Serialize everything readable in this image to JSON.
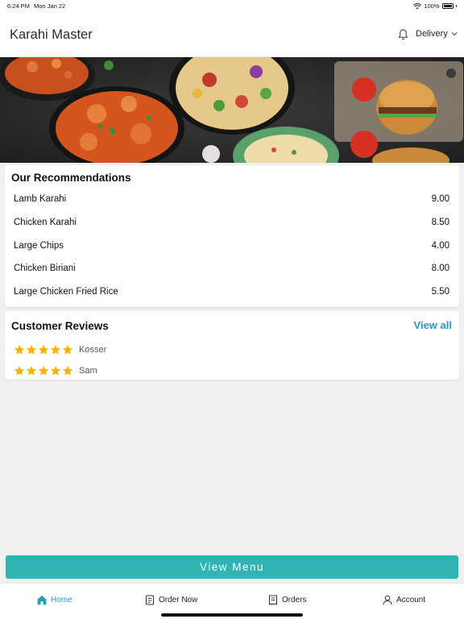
{
  "status_bar": {
    "time": "6:24 PM",
    "date": "Mon Jan 22",
    "battery": "100%"
  },
  "header": {
    "title": "Karahi Master",
    "order_mode": "Delivery"
  },
  "recommendations": {
    "title": "Our Recommendations",
    "items": [
      {
        "name": "Lamb Karahi",
        "price": "9.00"
      },
      {
        "name": "Chicken Karahi",
        "price": "8.50"
      },
      {
        "name": "Large Chips",
        "price": "4.00"
      },
      {
        "name": "Chicken Biriani",
        "price": "8.00"
      },
      {
        "name": "Large Chicken Fried Rice",
        "price": "5.50"
      }
    ]
  },
  "reviews": {
    "title": "Customer Reviews",
    "view_all_label": "View all",
    "items": [
      {
        "name": "Kosser",
        "rating": 5
      },
      {
        "name": "Sam",
        "rating": 5
      }
    ]
  },
  "view_menu_label": "View Menu",
  "tabs": {
    "home": "Home",
    "order_now": "Order Now",
    "orders": "Orders",
    "account": "Account"
  },
  "colors": {
    "accent": "#2fb3b3",
    "link": "#2a97c2",
    "active_tab": "#2a9fb0",
    "star": "#f5b400"
  },
  "icons": [
    "wifi-icon",
    "battery-icon",
    "bell-icon",
    "chevron-down-icon",
    "star-icon",
    "home-icon",
    "order-now-icon",
    "orders-icon",
    "account-icon"
  ]
}
